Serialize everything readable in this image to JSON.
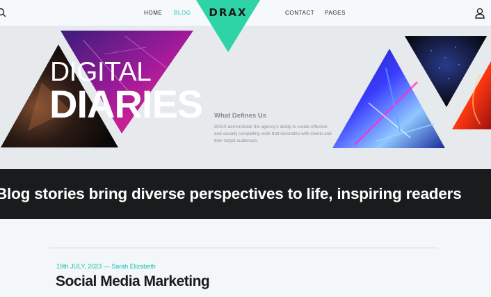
{
  "header": {
    "nav": [
      {
        "label": "HOME",
        "active": false
      },
      {
        "label": "BLOG",
        "active": true
      },
      {
        "label": "CONTACT",
        "active": false
      },
      {
        "label": "PAGES",
        "active": false
      }
    ],
    "logo": "DRAX",
    "icons": {
      "search": "search-icon",
      "user": "user-icon"
    },
    "accent": "#18c4b4",
    "logo_color": "#2ed3a6"
  },
  "hero": {
    "title_line1": "DIGITAL",
    "title_line2": "DIARIES",
    "subheading": "What Defines Us",
    "description": "DRAX demonstrate the agency's ability to create effective and visually compelling work that resonates with clients and their target audiences."
  },
  "ticker": {
    "text": "Blog stories bring diverse perspectives to life, inspiring readers"
  },
  "post": {
    "meta": "19th JULY, 2023 — Sarah Elizabeth",
    "title": "Social Media Marketing"
  }
}
